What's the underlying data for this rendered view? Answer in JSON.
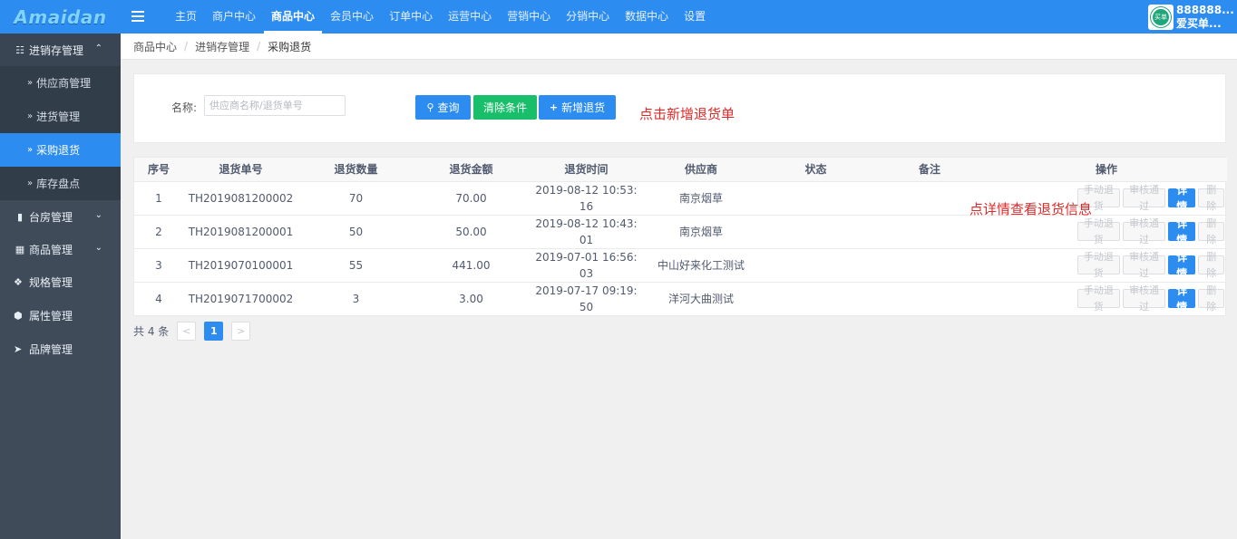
{
  "app": {
    "logo": "Amaidan"
  },
  "topnav": [
    {
      "label": "主页"
    },
    {
      "label": "商户中心"
    },
    {
      "label": "商品中心",
      "active": true
    },
    {
      "label": "会员中心"
    },
    {
      "label": "订单中心"
    },
    {
      "label": "运营中心"
    },
    {
      "label": "营销中心"
    },
    {
      "label": "分销中心"
    },
    {
      "label": "数据中心"
    },
    {
      "label": "设置"
    }
  ],
  "user": {
    "avatar_text": "买单",
    "line1": "888888...",
    "line2": "爱买单..."
  },
  "sidebar": {
    "group_open": {
      "label": "进销存管理",
      "icon": "map-icon",
      "chevron": "^"
    },
    "sub_items": [
      {
        "label": "供应商管理"
      },
      {
        "label": "进货管理"
      },
      {
        "label": "采购退货",
        "active": true
      },
      {
        "label": "库存盘点"
      }
    ],
    "groups": [
      {
        "label": "台房管理",
        "icon": "bookmark-icon",
        "chevron": "v"
      },
      {
        "label": "商品管理",
        "icon": "grid-icon",
        "chevron": "v"
      },
      {
        "label": "规格管理",
        "icon": "cubes-icon"
      },
      {
        "label": "属性管理",
        "icon": "cube-icon"
      },
      {
        "label": "品牌管理",
        "icon": "tags-icon"
      }
    ]
  },
  "breadcrumb": [
    "商品中心",
    "进销存管理",
    "采购退货"
  ],
  "search": {
    "label": "名称:",
    "placeholder": "供应商名称/退货单号",
    "query_button": "查询",
    "clear_button": "清除条件",
    "add_button": "新增退货"
  },
  "annotations": {
    "add_hint": "点击新增退货单",
    "detail_hint": "点详情查看退货信息"
  },
  "table": {
    "columns": [
      "序号",
      "退货单号",
      "退货数量",
      "退货金额",
      "退货时间",
      "供应商",
      "状态",
      "备注",
      "操作"
    ],
    "rows": [
      {
        "no": "1",
        "order": "TH2019081200002",
        "qty": "70",
        "amount": "70.00",
        "time1": "2019-08-12 10:53:",
        "time2": "16",
        "supplier": "南京烟草",
        "status": "",
        "remark": ""
      },
      {
        "no": "2",
        "order": "TH2019081200001",
        "qty": "50",
        "amount": "50.00",
        "time1": "2019-08-12 10:43:",
        "time2": "01",
        "supplier": "南京烟草",
        "status": "",
        "remark": ""
      },
      {
        "no": "3",
        "order": "TH2019070100001",
        "qty": "55",
        "amount": "441.00",
        "time1": "2019-07-01 16:56:",
        "time2": "03",
        "supplier": "中山好来化工测试",
        "status": "",
        "remark": ""
      },
      {
        "no": "4",
        "order": "TH2019071700002",
        "qty": "3",
        "amount": "3.00",
        "time1": "2019-07-17 09:19:",
        "time2": "50",
        "supplier": "洋河大曲测试",
        "status": "",
        "remark": ""
      }
    ],
    "actions": {
      "manual_return": "手动退货",
      "approve": "审核通过",
      "detail": "详情",
      "delete": "删除"
    }
  },
  "pagination": {
    "total_text": "共 4 条",
    "prev": "<",
    "current_page": "1",
    "next": ">"
  },
  "colors": {
    "primary": "#2d8cf0",
    "success": "#19be6b",
    "sidebar": "#3f4b59",
    "hint": "#e02a2a"
  }
}
